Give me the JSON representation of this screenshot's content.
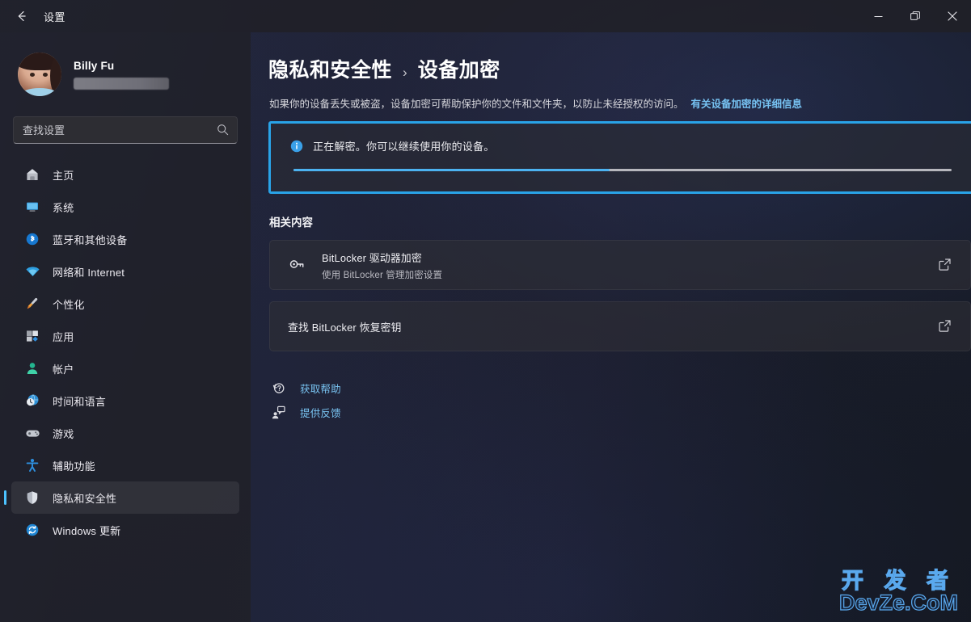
{
  "window": {
    "title": "设置",
    "back_icon": "back-arrow-icon",
    "controls": {
      "minimize": "minimize-icon",
      "maximize": "restore-icon",
      "close": "close-icon"
    }
  },
  "sidebar": {
    "profile": {
      "name": "Billy Fu",
      "account_masked": ""
    },
    "search": {
      "placeholder": "查找设置",
      "value": "",
      "icon": "search-icon"
    },
    "items": [
      {
        "label": "主页",
        "icon": "home-icon",
        "selected": false
      },
      {
        "label": "系统",
        "icon": "system-icon",
        "selected": false
      },
      {
        "label": "蓝牙和其他设备",
        "icon": "bluetooth-icon",
        "selected": false
      },
      {
        "label": "网络和 Internet",
        "icon": "wifi-icon",
        "selected": false
      },
      {
        "label": "个性化",
        "icon": "paintbrush-icon",
        "selected": false
      },
      {
        "label": "应用",
        "icon": "apps-icon",
        "selected": false
      },
      {
        "label": "帐户",
        "icon": "account-icon",
        "selected": false
      },
      {
        "label": "时间和语言",
        "icon": "clock-globe-icon",
        "selected": false
      },
      {
        "label": "游戏",
        "icon": "gamepad-icon",
        "selected": false
      },
      {
        "label": "辅助功能",
        "icon": "accessibility-icon",
        "selected": false
      },
      {
        "label": "隐私和安全性",
        "icon": "shield-icon",
        "selected": true
      },
      {
        "label": "Windows 更新",
        "icon": "update-icon",
        "selected": false
      }
    ]
  },
  "main": {
    "breadcrumb": {
      "root": "隐私和安全性",
      "separator": "›",
      "leaf": "设备加密"
    },
    "description": {
      "text": "如果你的设备丢失或被盗，设备加密可帮助保护你的文件和文件夹，以防止未经授权的访问。",
      "link": "有关设备加密的详细信息"
    },
    "status_card": {
      "icon": "info-icon",
      "message": "正在解密。你可以继续使用你的设备。",
      "progress_percent": 48,
      "focused": true,
      "focus_color": "#29a3e8",
      "progress_color": "#4cb2f0"
    },
    "related": {
      "title": "相关内容",
      "cards": [
        {
          "icon": "bitlocker-key-icon",
          "title": "BitLocker 驱动器加密",
          "subtitle": "使用 BitLocker 管理加密设置",
          "action_icon": "open-external-icon"
        },
        {
          "icon": "",
          "title": "查找 BitLocker 恢复密钥",
          "subtitle": "",
          "action_icon": "open-external-icon"
        }
      ]
    },
    "help_links": [
      {
        "label": "获取帮助",
        "icon": "help-question-icon"
      },
      {
        "label": "提供反馈",
        "icon": "feedback-icon"
      }
    ]
  },
  "watermark": {
    "line1": "开 发 者",
    "line2": "DevZe.CoM",
    "color": "#5aa9ee"
  }
}
